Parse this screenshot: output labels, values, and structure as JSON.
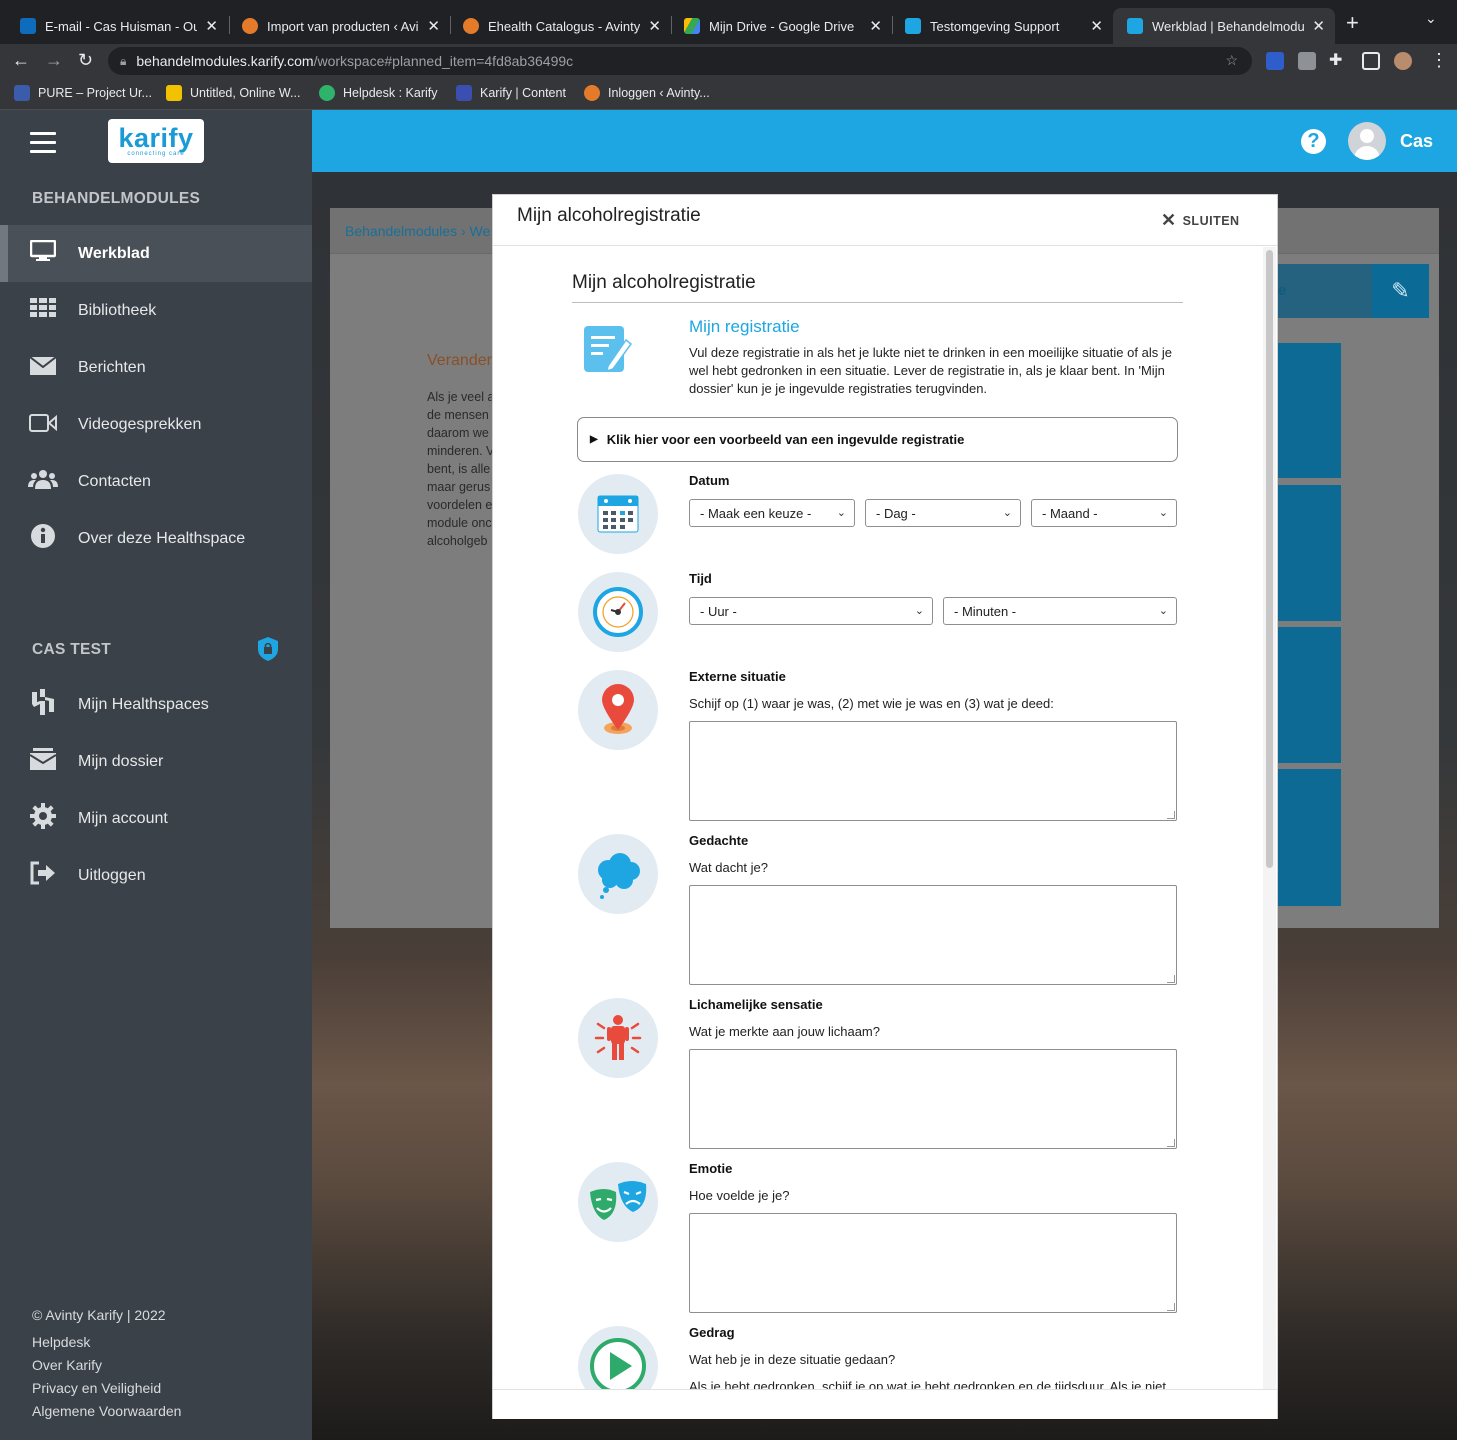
{
  "browser": {
    "tabs": [
      {
        "title": "E-mail - Cas Huisman - Outl",
        "color": "#0f6cbd",
        "left": 0
      },
      {
        "title": "Import van producten ‹ Avinty",
        "color": "#e37b2a"
      },
      {
        "title": "Ehealth Catalogus - Avinty",
        "color": "#e37b2a"
      },
      {
        "title": "Mijn Drive - Google Drive",
        "color": "#2ea44f"
      },
      {
        "title": "Testomgeving Support",
        "color": "#1da6e1"
      },
      {
        "title": "Werkblad | Behandelmodules",
        "color": "#1da6e1"
      }
    ],
    "url_host": "behandelmodules.karify.com",
    "url_path": "/workspace#planned_item=4fd8ab36499c",
    "bookmarks": [
      {
        "label": "PURE – Project Ur...",
        "color": "#3b5bab"
      },
      {
        "label": "Untitled, Online W...",
        "color": "#f2c200"
      },
      {
        "label": "Helpdesk : Karify",
        "color": "#2fb36b"
      },
      {
        "label": "Karify | Content",
        "color": "#3a4fb0"
      },
      {
        "label": "Inloggen ‹ Avinty...",
        "color": "#e37b2a"
      }
    ]
  },
  "sidebar": {
    "logo_word": "karify",
    "logo_tag": "connecting care",
    "section1": "BEHANDELMODULES",
    "items1": [
      {
        "label": "Werkblad",
        "icon": "monitor-icon"
      },
      {
        "label": "Bibliotheek",
        "icon": "grid-icon"
      },
      {
        "label": "Berichten",
        "icon": "envelope-icon"
      },
      {
        "label": "Videogesprekken",
        "icon": "video-icon"
      },
      {
        "label": "Contacten",
        "icon": "users-icon"
      },
      {
        "label": "Over deze Healthspace",
        "icon": "info-icon"
      }
    ],
    "section2": "CAS TEST",
    "items2": [
      {
        "label": "Mijn Healthspaces",
        "icon": "healthspace-icon"
      },
      {
        "label": "Mijn dossier",
        "icon": "inbox-icon"
      },
      {
        "label": "Mijn account",
        "icon": "gear-icon"
      },
      {
        "label": "Uitloggen",
        "icon": "logout-icon"
      }
    ],
    "footer": [
      "© Avinty Karify | 2022",
      "Helpdesk",
      "Over Karify",
      "Privacy en Veiligheid",
      "Algemene Voorwaarden"
    ]
  },
  "header": {
    "user": "Cas",
    "help": "?"
  },
  "background": {
    "crumb": "Behandelmodules  ›  We",
    "title": "Verander",
    "text": [
      "Als je veel a",
      "de mensen",
      "daarom we",
      "minderen. V",
      "bent, is alle",
      "maar gerus",
      "voordelen e",
      "module onc",
      "alcoholgeb"
    ],
    "strip": "e"
  },
  "modal": {
    "title": "Mijn alcoholregistratie",
    "close": "SLUITEN",
    "form_title": "Mijn alcoholregistratie",
    "reg_title": "Mijn registratie",
    "reg_desc": "Vul deze registratie in als het je lukte niet te drinken in een moeilijke situatie of als je wel hebt gedronken in een situatie. Lever de registratie in, als je klaar bent. In 'Mijn dossier' kun je je ingevulde registraties terugvinden.",
    "example": "Klik hier voor een voorbeeld van een ingevulde registratie",
    "datum": {
      "label": "Datum",
      "choice": "- Maak een keuze -",
      "day": "- Dag -",
      "month": "- Maand -"
    },
    "tijd": {
      "label": "Tijd",
      "hour": "- Uur -",
      "minutes": "- Minuten -"
    },
    "extern": {
      "label": "Externe situatie",
      "help": "Schijf op (1) waar je was, (2) met wie je was en (3) wat je deed:"
    },
    "gedachte": {
      "label": "Gedachte",
      "help": "Wat dacht je?"
    },
    "sensatie": {
      "label": "Lichamelijke sensatie",
      "help": "Wat je merkte aan jouw lichaam?"
    },
    "emotie": {
      "label": "Emotie",
      "help": "Hoe voelde je je?"
    },
    "gedrag": {
      "label": "Gedrag",
      "help": "Wat heb je in deze situatie gedaan?",
      "help2": "Als je hebt gedronken, schijf je op wat je hebt gedronken en de tijdsduur. Als je niet"
    }
  },
  "colors": {
    "accent": "#1da6e1",
    "sidebar": "#3b4148"
  }
}
